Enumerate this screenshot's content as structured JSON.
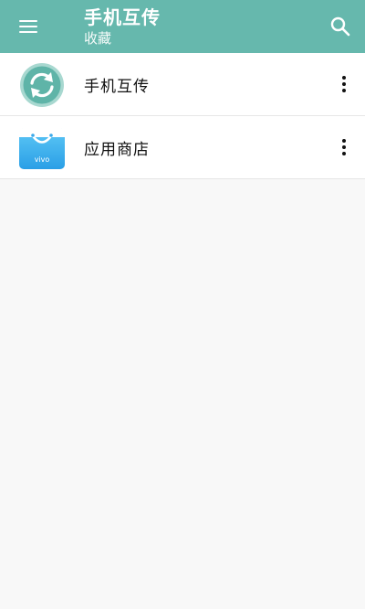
{
  "appbar": {
    "title": "手机互传",
    "subtitle": "收藏",
    "menu_icon": "hamburger-menu-icon",
    "search_icon": "search-icon",
    "color": "#66b8ad"
  },
  "list": {
    "items": [
      {
        "label": "手机互传",
        "icon": "transfer-app-icon",
        "more_icon": "more-vertical-icon"
      },
      {
        "label": "应用商店",
        "icon": "app-store-icon",
        "icon_text": "vivo",
        "more_icon": "more-vertical-icon"
      }
    ]
  }
}
